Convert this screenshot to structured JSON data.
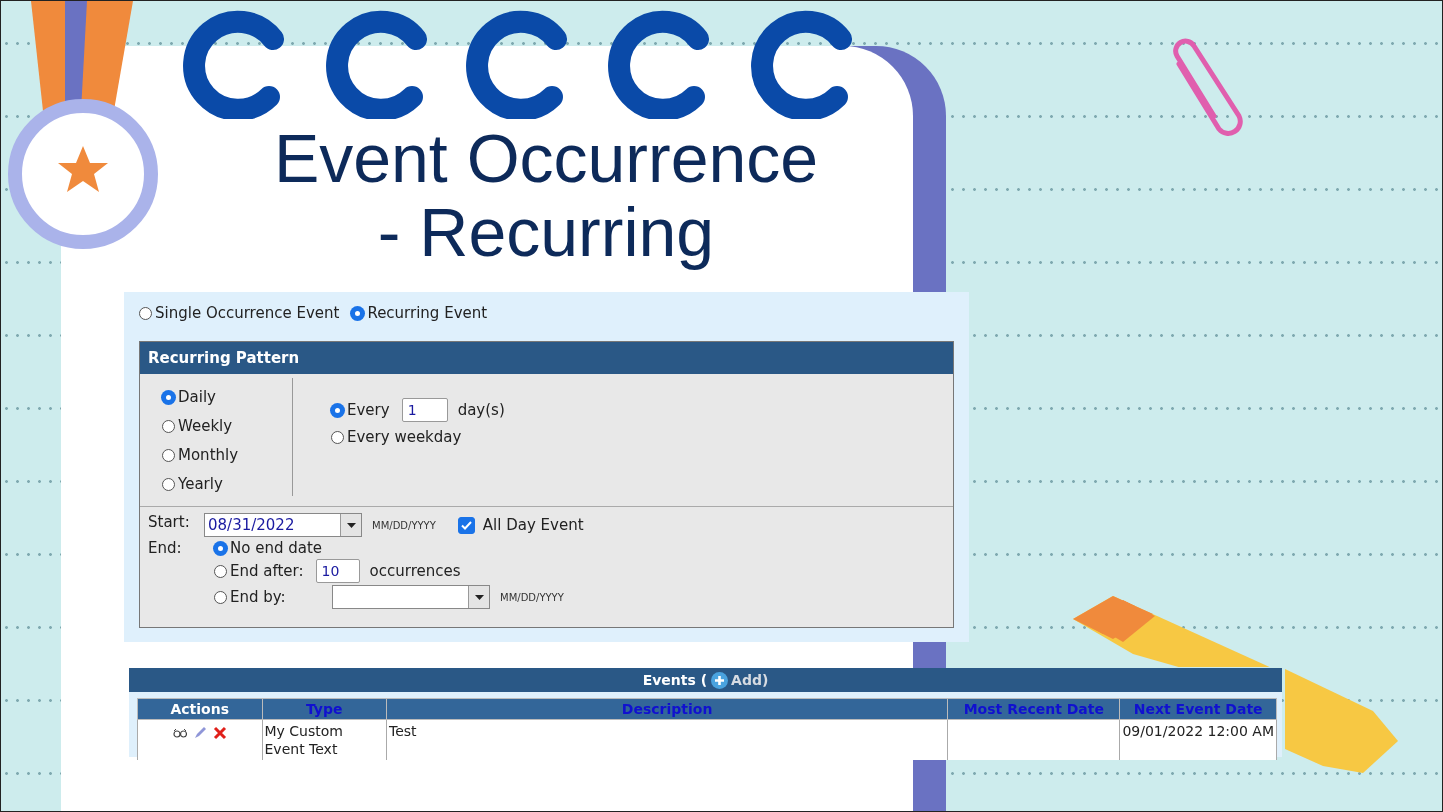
{
  "slide": {
    "title_lines": [
      "Event Occurrence",
      "- Recurring"
    ]
  },
  "occurrence_options": [
    {
      "label": "Single Occurrence Event",
      "selected": false
    },
    {
      "label": "Recurring Event",
      "selected": true
    }
  ],
  "recurring_pattern": {
    "title": "Recurring Pattern",
    "frequencies": [
      {
        "label": "Daily",
        "selected": true
      },
      {
        "label": "Weekly",
        "selected": false
      },
      {
        "label": "Monthly",
        "selected": false
      },
      {
        "label": "Yearly",
        "selected": false
      }
    ],
    "daily_options": [
      {
        "kind": "interval",
        "label": "Every",
        "value": "1",
        "unit": "day(s)",
        "selected": true
      },
      {
        "kind": "plain",
        "label": "Every weekday",
        "selected": false
      }
    ],
    "start": {
      "label": "Start:",
      "value": "08/31/2022",
      "format": "MM/DD/YYYY"
    },
    "all_day": {
      "label": "All Day Event",
      "checked": true
    },
    "end": {
      "label": "End:",
      "options": [
        {
          "kind": "plain",
          "label": "No end date",
          "selected": true
        },
        {
          "kind": "count",
          "label": "End after:",
          "value": "10",
          "unit": "occurrences",
          "selected": false
        },
        {
          "kind": "date",
          "label": "End by:",
          "format": "MM/DD/YYYY",
          "selected": false
        }
      ]
    }
  },
  "events": {
    "title": "Events (",
    "add_label": "Add)",
    "columns": [
      {
        "label": "Actions",
        "sortable": false
      },
      {
        "label": "Type",
        "sortable": true
      },
      {
        "label": "Description",
        "sortable": true
      },
      {
        "label": "Most Recent Date",
        "sortable": true
      },
      {
        "label": "Next Event Date",
        "sortable": true
      }
    ],
    "rows": [
      {
        "type": "My Custom Event Text",
        "description": "Test",
        "next_event_date": "09/01/2022 12:00 AM"
      }
    ]
  }
}
